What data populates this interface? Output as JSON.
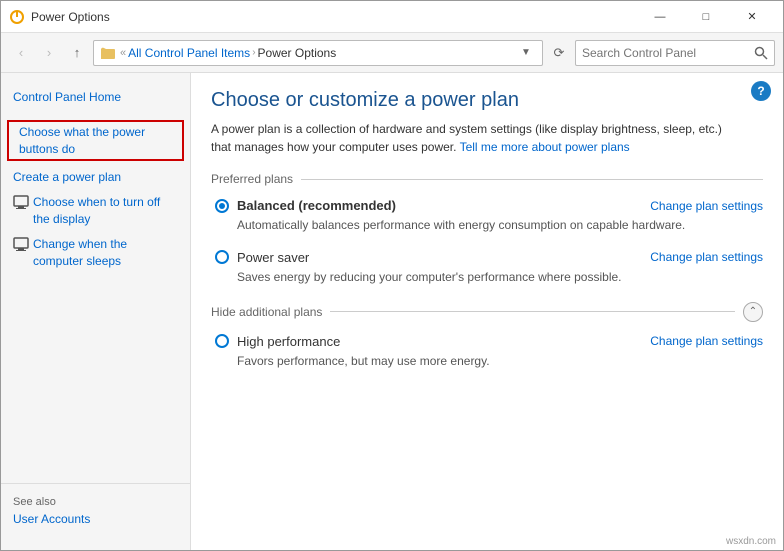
{
  "window": {
    "title": "Power Options",
    "title_icon": "power"
  },
  "titlebar": {
    "minimize_label": "—",
    "maximize_label": "□",
    "close_label": "✕"
  },
  "addressbar": {
    "back_label": "‹",
    "forward_label": "›",
    "up_label": "↑",
    "breadcrumb_home": "All Control Panel Items",
    "breadcrumb_current": "Power Options",
    "search_placeholder": "Search Control Panel",
    "refresh_label": "⟳"
  },
  "sidebar": {
    "home_link": "Control Panel Home",
    "items": [
      {
        "label": "Choose what the power buttons do",
        "highlighted": true,
        "has_icon": false
      },
      {
        "label": "Create a power plan",
        "highlighted": false,
        "has_icon": false
      },
      {
        "label": "Choose when to turn off the display",
        "highlighted": false,
        "has_icon": true
      },
      {
        "label": "Change when the computer sleeps",
        "highlighted": false,
        "has_icon": true
      }
    ],
    "see_also_label": "See also",
    "see_also_link": "User Accounts"
  },
  "content": {
    "title": "Choose or customize a power plan",
    "description": "A power plan is a collection of hardware and system settings (like display brightness, sleep, etc.) that manages how your computer uses power.",
    "description_link_text": "Tell me more about power plans",
    "preferred_plans_label": "Preferred plans",
    "plans": [
      {
        "id": "balanced",
        "name": "Balanced (recommended)",
        "selected": true,
        "description": "Automatically balances performance with energy consumption on capable hardware.",
        "change_link": "Change plan settings"
      },
      {
        "id": "power_saver",
        "name": "Power saver",
        "selected": false,
        "description": "Saves energy by reducing your computer's performance where possible.",
        "change_link": "Change plan settings"
      }
    ],
    "hide_additional_label": "Hide additional plans",
    "additional_plans": [
      {
        "id": "high_performance",
        "name": "High performance",
        "selected": false,
        "description": "Favors performance, but may use more energy.",
        "change_link": "Change plan settings"
      }
    ]
  },
  "watermark": "wsxdn.com"
}
